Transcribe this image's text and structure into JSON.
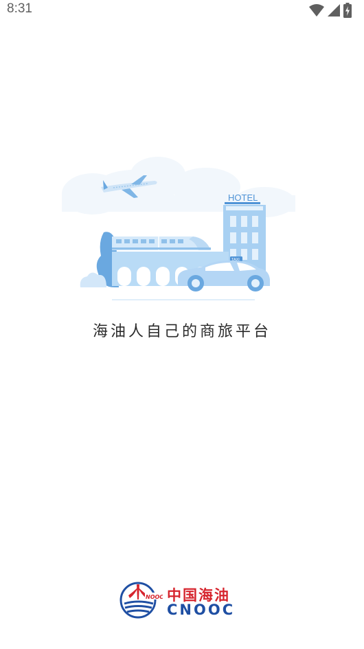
{
  "status_bar": {
    "time": "8:31",
    "icons": [
      "wifi-icon",
      "cell-signal-icon",
      "battery-charging-icon"
    ]
  },
  "splash": {
    "illustration": {
      "hotel_sign": "HOTEL",
      "taxi_sign": "TAXI",
      "theme_color": "#a8d0f2"
    },
    "tagline": "海油人自己的商旅平台"
  },
  "brand": {
    "name_cn": "中国海油",
    "name_en": "CNOOC",
    "emblem_text": "NOOC",
    "colors": {
      "red": "#d6242d",
      "blue": "#1f4fa3"
    }
  }
}
